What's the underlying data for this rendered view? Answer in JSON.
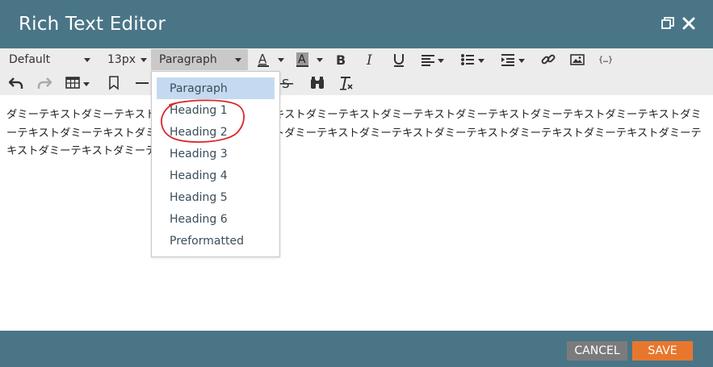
{
  "window": {
    "title": "Rich Text Editor"
  },
  "toolbar": {
    "font_family": "Default",
    "font_size": "13px",
    "block_format": "Paragraph",
    "icons": [
      "font-color-icon",
      "background-color-icon",
      "bold-icon",
      "italic-icon",
      "underline-icon",
      "align-icon",
      "bullet-list-icon",
      "indent-icon",
      "link-icon",
      "image-icon",
      "code-icon",
      "undo-icon",
      "redo-icon",
      "table-icon",
      "bookmark-icon",
      "horizontal-rule-icon",
      "strikethrough-icon",
      "find-icon",
      "clear-format-icon"
    ]
  },
  "editor": {
    "content": "ダミーテキストダミーテキストダミーテキストダミーテキストダミーテキストダミーテキストダミーテキストダミーテキストダミーテキストダミーテキストダミーテキストダミーテキストダミーテキストダミーテキストダミーテキストダミーテキストダミーテキストダミーテキストダミーテキストダミーテキストダミーテキストダミーテキスト"
  },
  "format_dropdown": {
    "items": [
      "Paragraph",
      "Heading 1",
      "Heading 2",
      "Heading 3",
      "Heading 4",
      "Heading 5",
      "Heading 6",
      "Preformatted"
    ],
    "selected": "Paragraph"
  },
  "footer": {
    "cancel_label": "CANCEL",
    "save_label": "SAVE"
  },
  "colors": {
    "header_bg": "#4a7587",
    "save_bg": "#e8772e",
    "cancel_bg": "#7b7b7b",
    "selected_item_bg": "#c5daf0",
    "annotation": "#d8262a"
  }
}
